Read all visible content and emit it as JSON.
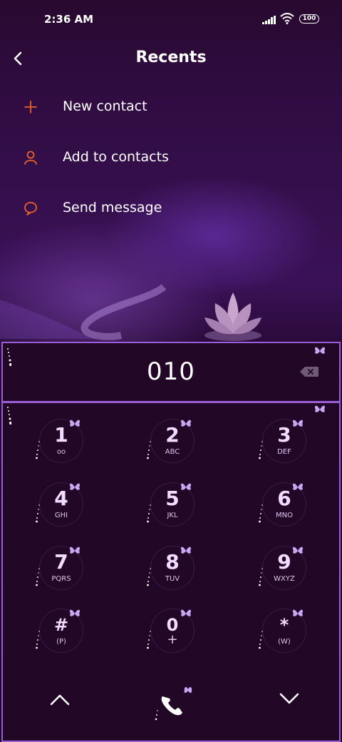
{
  "status_bar": {
    "time": "2:36 AM",
    "battery": "100",
    "icons": [
      "signal-icon",
      "wifi-icon",
      "battery-icon"
    ]
  },
  "header": {
    "title": "Recents",
    "back_icon": "chevron-left-icon"
  },
  "menu": [
    {
      "label": "New contact",
      "icon": "plus-icon"
    },
    {
      "label": "Add to contacts",
      "icon": "person-icon"
    },
    {
      "label": "Send message",
      "icon": "message-bubble-icon"
    }
  ],
  "dialer": {
    "number": "010",
    "delete_icon": "backspace-icon"
  },
  "keypad": [
    {
      "digit": "1",
      "letters": "oo"
    },
    {
      "digit": "2",
      "letters": "ABC"
    },
    {
      "digit": "3",
      "letters": "DEF"
    },
    {
      "digit": "4",
      "letters": "GHI"
    },
    {
      "digit": "5",
      "letters": "JKL"
    },
    {
      "digit": "6",
      "letters": "MNO"
    },
    {
      "digit": "7",
      "letters": "PQRS"
    },
    {
      "digit": "8",
      "letters": "TUV"
    },
    {
      "digit": "9",
      "letters": "WXYZ"
    },
    {
      "digit": "#",
      "letters": "(P)"
    },
    {
      "digit": "0",
      "letters": "+"
    },
    {
      "digit": "*",
      "letters": "(W)"
    }
  ],
  "bottom_bar": {
    "icons": [
      "chevron-up-icon",
      "phone-call-icon",
      "chevron-down-icon"
    ]
  },
  "colors": {
    "accent": "#e8622a",
    "panel_border": "#9a5fd6",
    "background": "#24092f"
  }
}
